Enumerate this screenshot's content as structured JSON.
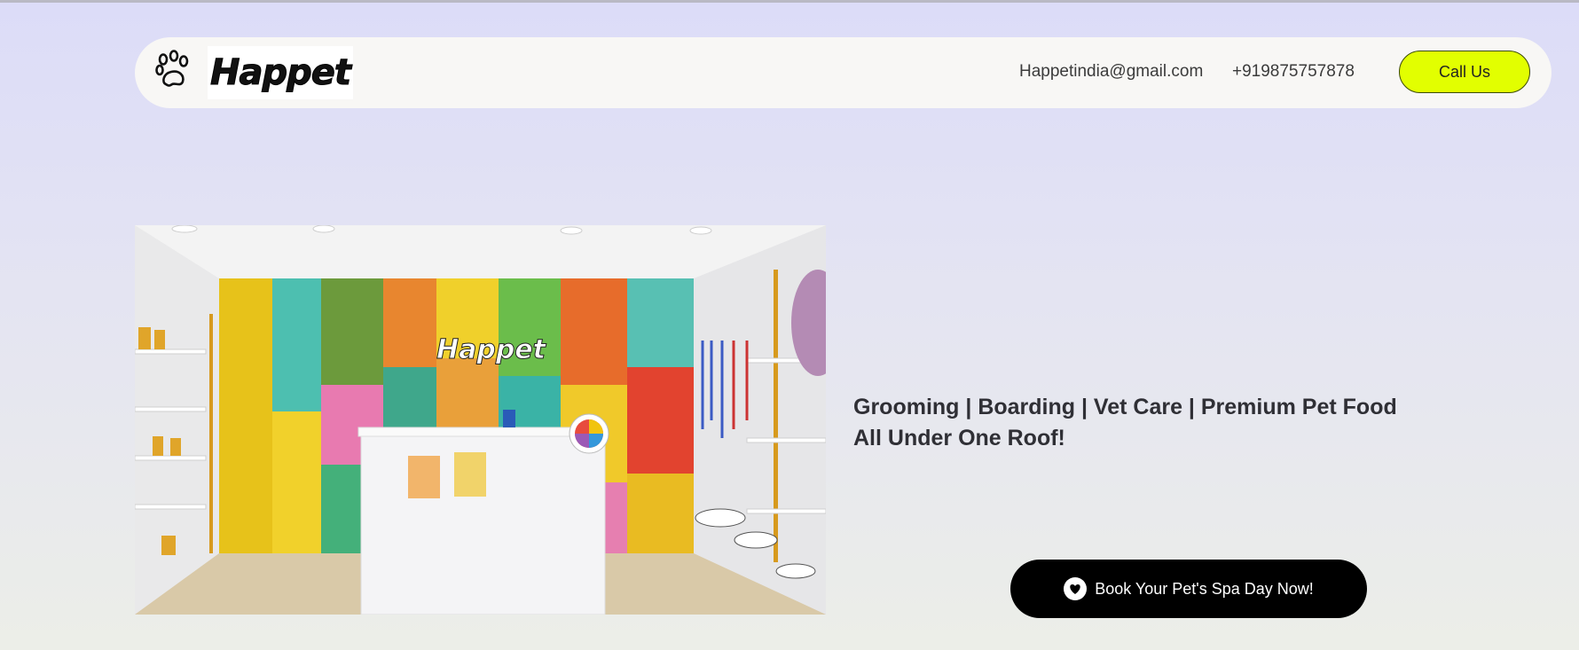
{
  "header": {
    "logo_text": "Happet",
    "email": "Happetindia@gmail.com",
    "phone": "+919875757878",
    "call_label": "Call Us",
    "call_color": "#e2ff00"
  },
  "hero": {
    "image_logo_text": "Happet",
    "headline_line1": "Grooming | Boarding | Vet Care | Premium Pet Food",
    "headline_line2": "All Under One Roof!",
    "cta_label": "Book Your Pet's Spa Day Now!",
    "cta_icon": "heart-icon"
  }
}
